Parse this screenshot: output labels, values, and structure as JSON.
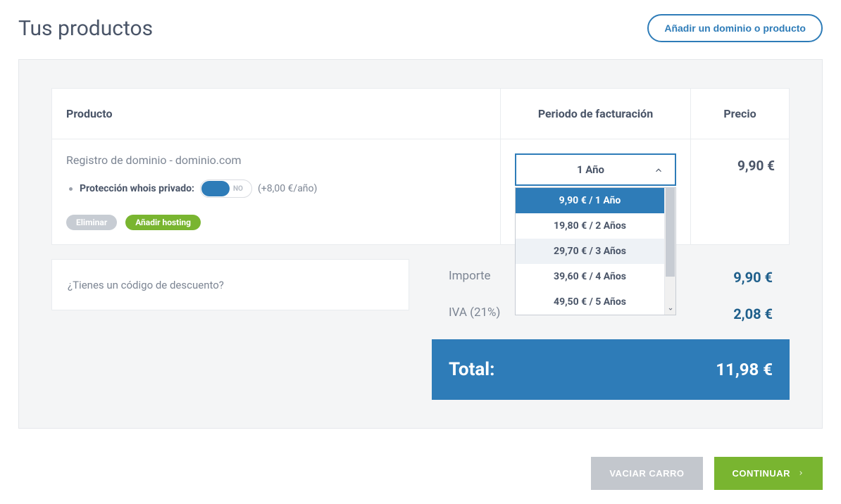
{
  "header": {
    "title": "Tus productos",
    "add_button": "Añadir un dominio o producto"
  },
  "table": {
    "columns": {
      "product": "Producto",
      "period": "Periodo de facturación",
      "price": "Precio"
    },
    "row": {
      "name": "Registro de dominio - dominio.com",
      "whois_label": "Protección whois privado:",
      "whois_toggle_no": "NO",
      "whois_price_note": "(+8,00 €/año)",
      "delete_label": "Eliminar",
      "add_hosting_label": "Añadir hosting",
      "selected_period": "1 Año",
      "price": "9,90 €",
      "period_options": [
        {
          "label": "9,90 € / 1 Año",
          "selected": true
        },
        {
          "label": "19,80 € / 2 Años",
          "selected": false
        },
        {
          "label": "29,70 € / 3 Años",
          "selected": false,
          "hover": true
        },
        {
          "label": "39,60 € / 4 Años",
          "selected": false
        },
        {
          "label": "49,50 € / 5 Años",
          "selected": false
        }
      ]
    }
  },
  "discount": {
    "prompt": "¿Tienes un código de descuento?"
  },
  "totals": {
    "subtotal_label": "Importe",
    "subtotal_value": "9,90 €",
    "vat_label": "IVA (21%)",
    "vat_value": "2,08 €",
    "total_label": "Total:",
    "total_value": "11,98 €"
  },
  "footer": {
    "empty_cart": "VACIAR CARRO",
    "continue": "CONTINUAR"
  }
}
